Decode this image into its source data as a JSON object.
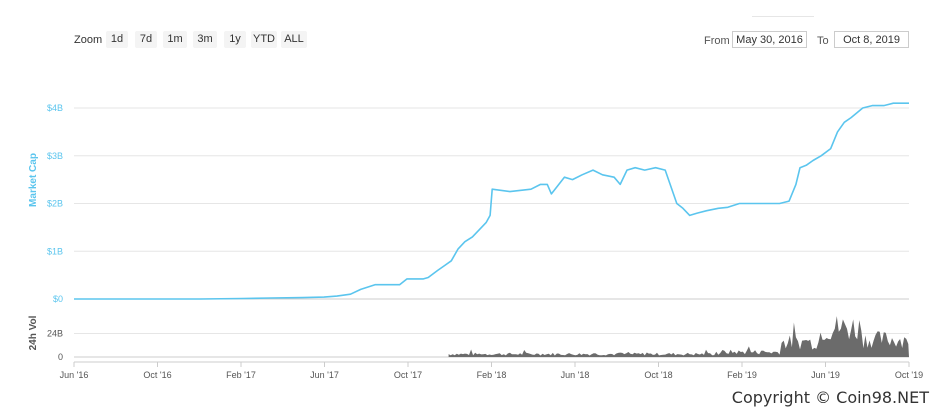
{
  "toolbar": {
    "zoom_label": "Zoom",
    "zoom_buttons": [
      "1d",
      "7d",
      "1m",
      "3m",
      "1y",
      "YTD",
      "ALL"
    ],
    "from_label": "From",
    "from_value": "May 30, 2016",
    "to_label": "To",
    "to_value": "Oct 8, 2019"
  },
  "copyright": "Copyright © Coin98.NET",
  "colors": {
    "line": "#5bc5ee",
    "volume": "#6b6b6b",
    "axis_text": "#5bc5ee",
    "grid": "#e6e6e6"
  },
  "chart_data": {
    "type": "line",
    "ylabel": "Market Cap",
    "ylim": [
      0,
      4.3
    ],
    "y_ticks": [
      "$0",
      "$1B",
      "$2B",
      "$3B",
      "$4B"
    ],
    "x_ticks": [
      "Jun '16",
      "Oct '16",
      "Feb '17",
      "Jun '17",
      "Oct '17",
      "Feb '18",
      "Jun '18",
      "Oct '18",
      "Feb '19",
      "Jun '19",
      "Oct '19"
    ],
    "x_range": [
      "2016-05-30",
      "2019-10-08"
    ],
    "series": [
      {
        "x": [
          "2016-05-30",
          "2016-08-01",
          "2016-10-01",
          "2016-12-01",
          "2017-02-01",
          "2017-03-15",
          "2017-05-01",
          "2017-06-01",
          "2017-06-20",
          "2017-07-10",
          "2017-07-25",
          "2017-08-15",
          "2017-09-20",
          "2017-10-01",
          "2017-10-25",
          "2017-11-01",
          "2017-11-15",
          "2017-11-25",
          "2017-12-05",
          "2017-12-15",
          "2017-12-25",
          "2018-01-05",
          "2018-01-15",
          "2018-01-25",
          "2018-01-31",
          "2018-02-03",
          "2018-03-01",
          "2018-04-01",
          "2018-04-15",
          "2018-04-25",
          "2018-05-01",
          "2018-05-20",
          "2018-06-01",
          "2018-06-15",
          "2018-07-01",
          "2018-07-15",
          "2018-08-01",
          "2018-08-10",
          "2018-08-20",
          "2018-09-01",
          "2018-09-15",
          "2018-10-01",
          "2018-10-15",
          "2018-11-01",
          "2018-11-10",
          "2018-11-20",
          "2018-12-01",
          "2018-12-15",
          "2019-01-01",
          "2019-01-15",
          "2019-02-01",
          "2019-03-01",
          "2019-04-01",
          "2019-04-15",
          "2019-04-25",
          "2019-05-01",
          "2019-05-10",
          "2019-05-20",
          "2019-06-01",
          "2019-06-15",
          "2019-06-25",
          "2019-07-05",
          "2019-07-15",
          "2019-08-01",
          "2019-08-15",
          "2019-09-01",
          "2019-09-15",
          "2019-10-08"
        ],
        "values": [
          0.0,
          0.0,
          0.0,
          0.0,
          0.01,
          0.02,
          0.03,
          0.04,
          0.06,
          0.1,
          0.2,
          0.3,
          0.3,
          0.42,
          0.42,
          0.45,
          0.6,
          0.7,
          0.8,
          1.05,
          1.2,
          1.3,
          1.45,
          1.6,
          1.75,
          2.3,
          2.25,
          2.3,
          2.4,
          2.4,
          2.2,
          2.55,
          2.5,
          2.6,
          2.7,
          2.6,
          2.55,
          2.4,
          2.7,
          2.75,
          2.7,
          2.75,
          2.7,
          2.0,
          1.9,
          1.75,
          1.8,
          1.85,
          1.9,
          1.92,
          2.0,
          2.0,
          2.0,
          2.05,
          2.4,
          2.75,
          2.8,
          2.9,
          3.0,
          3.15,
          3.5,
          3.7,
          3.8,
          4.0,
          4.05,
          4.05,
          4.1,
          4.1
        ]
      }
    ],
    "volume": {
      "ylabel": "24h Vol",
      "y_ticks": [
        "0",
        "24B"
      ],
      "ylim": [
        0,
        48
      ],
      "start": "2017-12-01",
      "end": "2019-10-08",
      "levels": [
        {
          "from": "2017-12-01",
          "to": "2018-12-31",
          "value": 3
        },
        {
          "from": "2019-01-01",
          "to": "2019-03-31",
          "value": 5
        },
        {
          "from": "2019-04-01",
          "to": "2019-05-31",
          "value": 15
        },
        {
          "from": "2019-06-01",
          "to": "2019-07-31",
          "value": 30
        },
        {
          "from": "2019-08-01",
          "to": "2019-10-08",
          "value": 18
        }
      ]
    }
  }
}
